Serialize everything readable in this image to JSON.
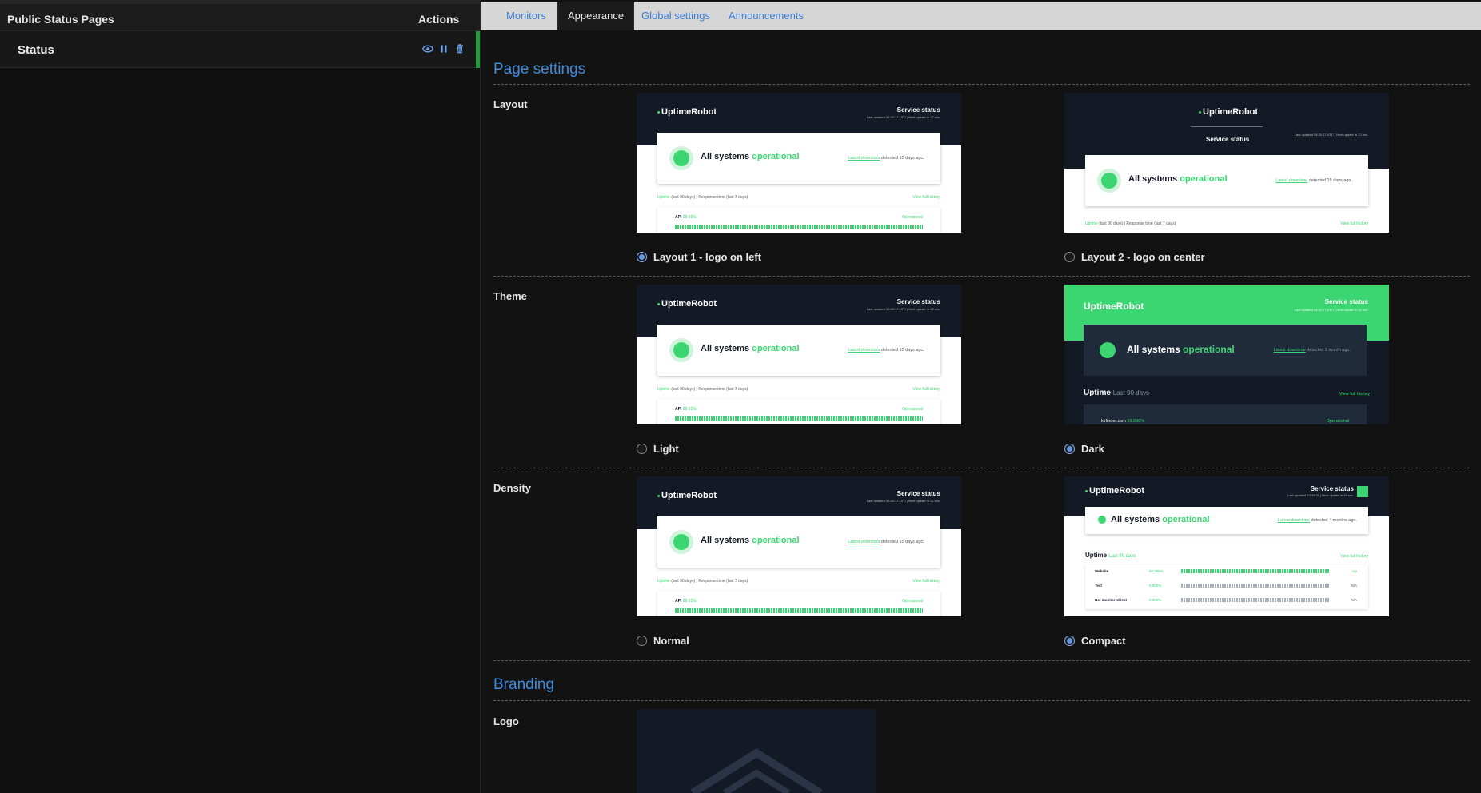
{
  "sidebar": {
    "title": "Public Status Pages",
    "actions_label": "Actions",
    "rows": [
      {
        "name": "Status"
      }
    ]
  },
  "tabs": [
    {
      "label": "Monitors",
      "active": false
    },
    {
      "label": "Appearance",
      "active": true
    },
    {
      "label": "Global settings",
      "active": false
    },
    {
      "label": "Announcements",
      "active": false
    }
  ],
  "page_settings": {
    "title": "Page settings",
    "layout": {
      "label": "Layout",
      "options": [
        {
          "label": "Layout 1 - logo on left",
          "selected": true
        },
        {
          "label": "Layout 2 - logo on center",
          "selected": false
        }
      ]
    },
    "theme": {
      "label": "Theme",
      "options": [
        {
          "label": "Light",
          "selected": false
        },
        {
          "label": "Dark",
          "selected": true
        }
      ]
    },
    "density": {
      "label": "Density",
      "options": [
        {
          "label": "Normal",
          "selected": false
        },
        {
          "label": "Compact",
          "selected": true
        }
      ]
    }
  },
  "preview": {
    "logo": "UptimeRobot",
    "service_status": "Service status",
    "last_updated": "Last updated 08:20:17 UTC | Next update in 12 sec.",
    "last_updated_compact": "Last updated 13:44:31 | Next update in 19 sec.",
    "all_systems": "All systems",
    "operational": "operational",
    "latest_downtime": "Latest downtime",
    "detected_15": "detected 15 days ago.",
    "detected_month": "detected 1 month ago.",
    "detected_4months": "detected 4 months ago.",
    "uptime_label": "Uptime",
    "uptime_hint": "(last 90 days)",
    "response_time": "Response time",
    "response_hint": "(last 7 days)",
    "view_full_history": "View full history",
    "monitor_name": "API",
    "monitor_pct": "99.92%",
    "monitor_status": "Operational",
    "uptime_big": "Uptime",
    "last_90": "Last 90 days",
    "dark_monitor": "kvfinder.com",
    "dark_pct": "99.996%",
    "compact_rows": [
      {
        "name": "Website",
        "pct": "99.985%",
        "status": "Up"
      },
      {
        "name": "Test",
        "pct": "0.000%",
        "status": "N/A"
      },
      {
        "name": "Not monitored test",
        "pct": "0.000%",
        "status": "N/A"
      }
    ]
  },
  "branding": {
    "title": "Branding",
    "logo_label": "Logo"
  },
  "colors": {
    "accent": "#3d8dde",
    "brand_green": "#3bd671",
    "dark_navy": "#131a26"
  }
}
